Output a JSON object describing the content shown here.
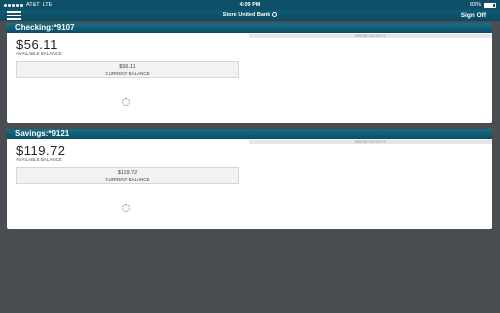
{
  "status_bar": {
    "carrier": "AT&T",
    "network": "LTE",
    "time": "4:09 PM",
    "battery": "83%",
    "battery_level": 0.83
  },
  "nav": {
    "title": "Store United Bank",
    "signoff_label": "Sign Off"
  },
  "accounts": [
    {
      "header": "Checking:*9107",
      "available_balance": "$56.11",
      "available_label": "AVAILABLE BALANCE",
      "current_balance": "$56.11",
      "current_label": "CURRENT BALANCE",
      "recent_activity_label": "RECENT ACTIVITY"
    },
    {
      "header": "Savings:*9121",
      "available_balance": "$119.72",
      "available_label": "AVAILABLE BALANCE",
      "current_balance": "$119.72",
      "current_label": "CURRENT BALANCE",
      "recent_activity_label": "RECENT ACTIVITY"
    }
  ]
}
